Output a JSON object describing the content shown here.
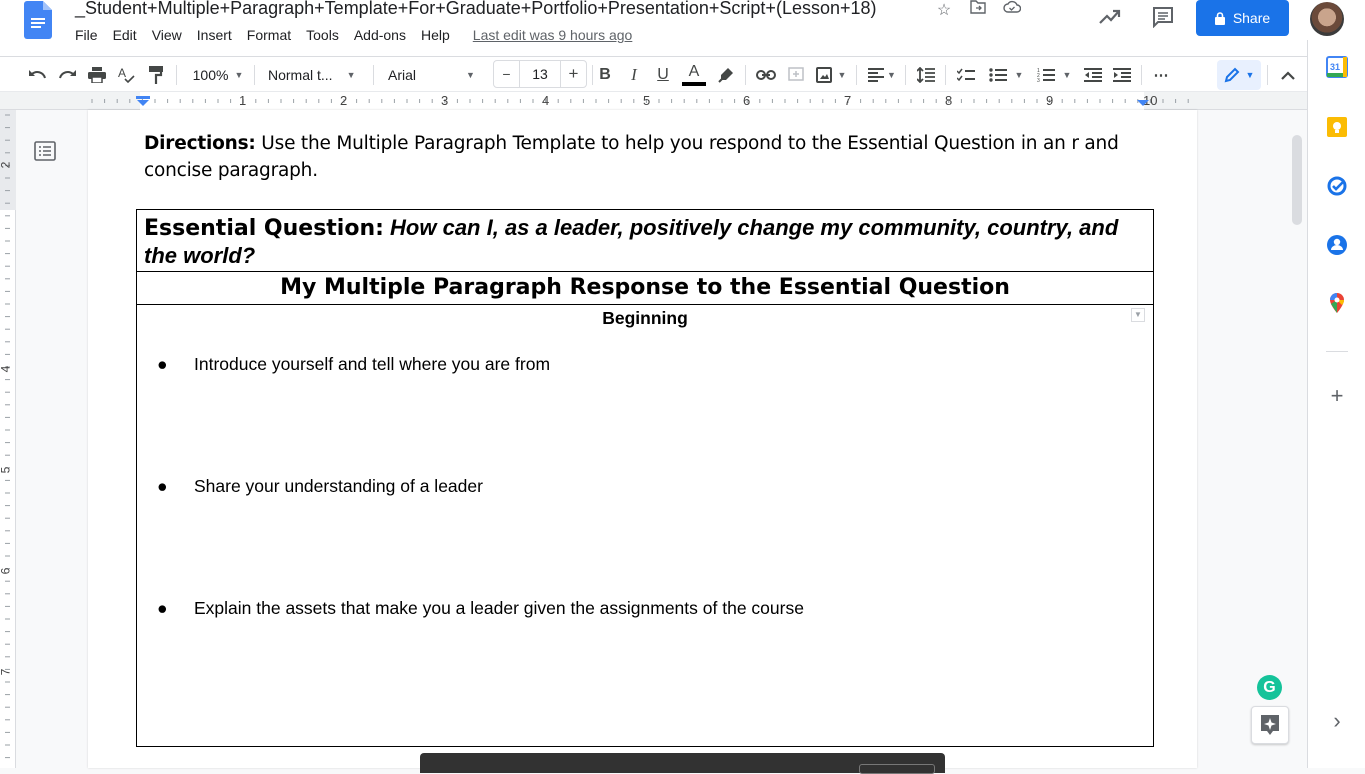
{
  "header": {
    "doc_title": "_Student+Multiple+Paragraph+Template+For+Graduate+Portfolio+Presentation+Script+(Lesson+18)",
    "last_edit": "Last edit was 9 hours ago",
    "share_label": "Share",
    "title_icons": [
      "star-icon",
      "move-to-folder-icon",
      "cloud-saved-icon"
    ]
  },
  "menu": [
    "File",
    "Edit",
    "View",
    "Insert",
    "Format",
    "Tools",
    "Add-ons",
    "Help"
  ],
  "toolbar": {
    "zoom": "100%",
    "style": "Normal t...",
    "font": "Arial",
    "font_size": "13",
    "minus": "−",
    "plus": "+",
    "bold": "B",
    "italic": "I",
    "underline": "U",
    "text_color": "A",
    "more": "⋯"
  },
  "ruler": {
    "h_numbers": [
      "1",
      "2",
      "3",
      "4",
      "5",
      "6",
      "7",
      "8",
      "9",
      "10"
    ],
    "v_numbers": [
      "2",
      "4",
      "5",
      "6",
      "7"
    ]
  },
  "document": {
    "directions_label": "Directions:",
    "directions_text": "  Use the Multiple Paragraph Template to help you respond to the Essential Question in an r and concise paragraph.",
    "eq_label": "Essential Question:",
    "eq_text": " How can I, as a leader, positively change my community, country, and the world?",
    "response_title": "My Multiple Paragraph Response to the Essential Question",
    "section_title": "Beginning",
    "bullets": [
      "Introduce yourself and tell where you are from",
      "Share your understanding of a leader",
      "Explain the assets that make you a leader given the assignments of the course"
    ],
    "bullet_glyph": "●"
  },
  "side_panel": {
    "apps": [
      "calendar-icon",
      "keep-icon",
      "tasks-icon",
      "contacts-icon",
      "maps-icon"
    ],
    "add": "+",
    "expand": "›"
  },
  "colors": {
    "accent": "#1a73e8",
    "grammarly": "#15c39a"
  }
}
